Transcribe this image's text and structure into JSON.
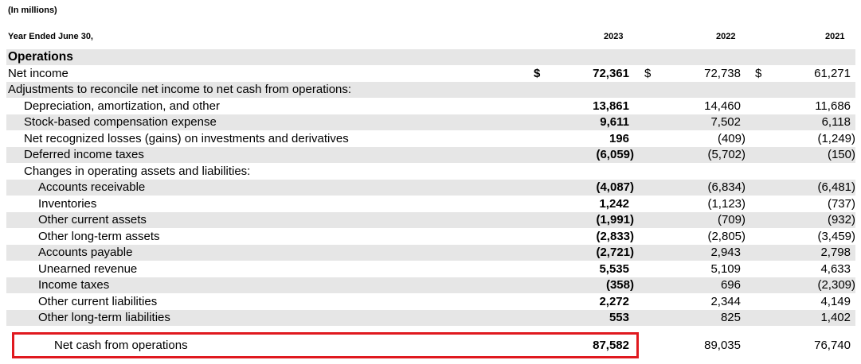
{
  "units_note": "(In millions)",
  "period_label": "Year Ended June 30,",
  "years": [
    "2023",
    "2022",
    "2021"
  ],
  "rows": [
    {
      "label": "Operations",
      "section": true
    },
    {
      "label": "Net income",
      "cur": [
        "$",
        "$",
        "$"
      ],
      "values": [
        "72,361",
        "72,738",
        "61,271"
      ]
    },
    {
      "label": "Adjustments to reconcile net income to net cash from operations:"
    },
    {
      "label": "Depreciation, amortization, and other",
      "values": [
        "13,861",
        "14,460",
        "11,686"
      ]
    },
    {
      "label": "Stock-based compensation expense",
      "values": [
        "9,611",
        "7,502",
        "6,118"
      ]
    },
    {
      "label": "Net recognized losses (gains) on investments and derivatives",
      "values": [
        "196",
        "(409)",
        "(1,249)"
      ]
    },
    {
      "label": "Deferred income taxes",
      "values": [
        "(6,059)",
        "(5,702)",
        "(150)"
      ]
    },
    {
      "label": "Changes in operating assets and liabilities:"
    },
    {
      "label": "Accounts receivable",
      "values": [
        "(4,087)",
        "(6,834)",
        "(6,481)"
      ]
    },
    {
      "label": "Inventories",
      "values": [
        "1,242",
        "(1,123)",
        "(737)"
      ]
    },
    {
      "label": "Other current assets",
      "values": [
        "(1,991)",
        "(709)",
        "(932)"
      ]
    },
    {
      "label": "Other long-term assets",
      "values": [
        "(2,833)",
        "(2,805)",
        "(3,459)"
      ]
    },
    {
      "label": "Accounts payable",
      "values": [
        "(2,721)",
        "2,943",
        "2,798"
      ]
    },
    {
      "label": "Unearned revenue",
      "values": [
        "5,535",
        "5,109",
        "4,633"
      ]
    },
    {
      "label": "Income taxes",
      "values": [
        "(358)",
        "696",
        "(2,309)"
      ]
    },
    {
      "label": "Other current liabilities",
      "values": [
        "2,272",
        "2,344",
        "4,149"
      ]
    },
    {
      "label": "Other long-term liabilities",
      "values": [
        "553",
        "825",
        "1,402"
      ]
    },
    {
      "label": "Net cash from operations",
      "values": [
        "87,582",
        "89,035",
        "76,740"
      ]
    }
  ]
}
